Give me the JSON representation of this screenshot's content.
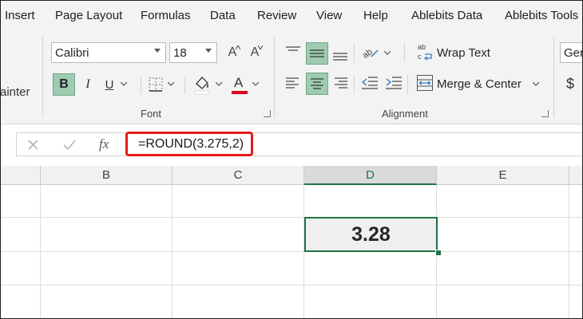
{
  "tabs": [
    "Insert",
    "Page Layout",
    "Formulas",
    "Data",
    "Review",
    "View",
    "Help",
    "Ablebits Data",
    "Ablebits Tools"
  ],
  "ribbon": {
    "left_cut_label": "ainter",
    "font": {
      "font_name": "Calibri",
      "font_size": "18",
      "bold": "B",
      "italic": "I",
      "underline": "U",
      "font_color_letter": "A",
      "grow_font": "A",
      "shrink_font": "A",
      "group_label": "Font"
    },
    "alignment": {
      "wrap_text": "Wrap Text",
      "merge_center": "Merge & Center",
      "group_label": "Alignment"
    },
    "right_cut_label": "Gen",
    "dollar": "$"
  },
  "formula_bar": {
    "cancel": "✕",
    "enter": "✓",
    "fx": "fx",
    "formula": "=ROUND(3.275,2)"
  },
  "columns": [
    "B",
    "C",
    "D",
    "E"
  ],
  "active_column": "D",
  "selected_cell_value": "3.28",
  "colors": {
    "accent_green": "#217346",
    "highlight_red": "#e21b1b",
    "selected_button": "#9fcbb0",
    "font_color_bar": "#e2001a"
  }
}
